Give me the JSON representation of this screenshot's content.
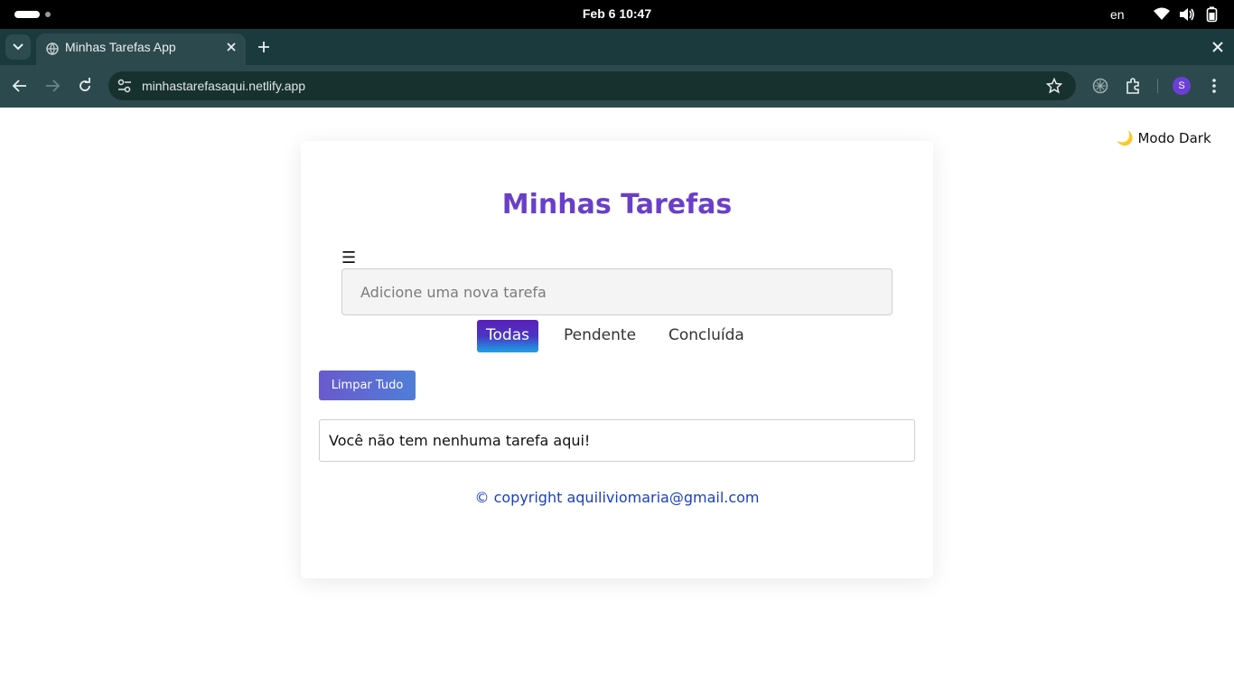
{
  "system": {
    "clock": "Feb 6  10:47",
    "language": "en"
  },
  "browser": {
    "tab_title": "Minhas Tarefas App",
    "url": "minhastarefasaqui.netlify.app",
    "profile_initial": "S"
  },
  "page": {
    "dark_mode_label": "🌙 Modo Dark",
    "title": "Minhas Tarefas",
    "menu_glyph": "☰",
    "input": {
      "value": "",
      "placeholder": "Adicione uma nova tarefa"
    },
    "filters": [
      {
        "label": "Todas",
        "active": true
      },
      {
        "label": "Pendente",
        "active": false
      },
      {
        "label": "Concluída",
        "active": false
      }
    ],
    "clear_all_label": "Limpar Tudo",
    "empty_message": "Você não tem nenhuma tarefa aqui!",
    "copyright": "© copyright aquiliviomaria@gmail.com"
  },
  "colors": {
    "title": "#6a3fc8",
    "copyright": "#1a3fbf",
    "browser_chrome": "#2c4a4d"
  }
}
